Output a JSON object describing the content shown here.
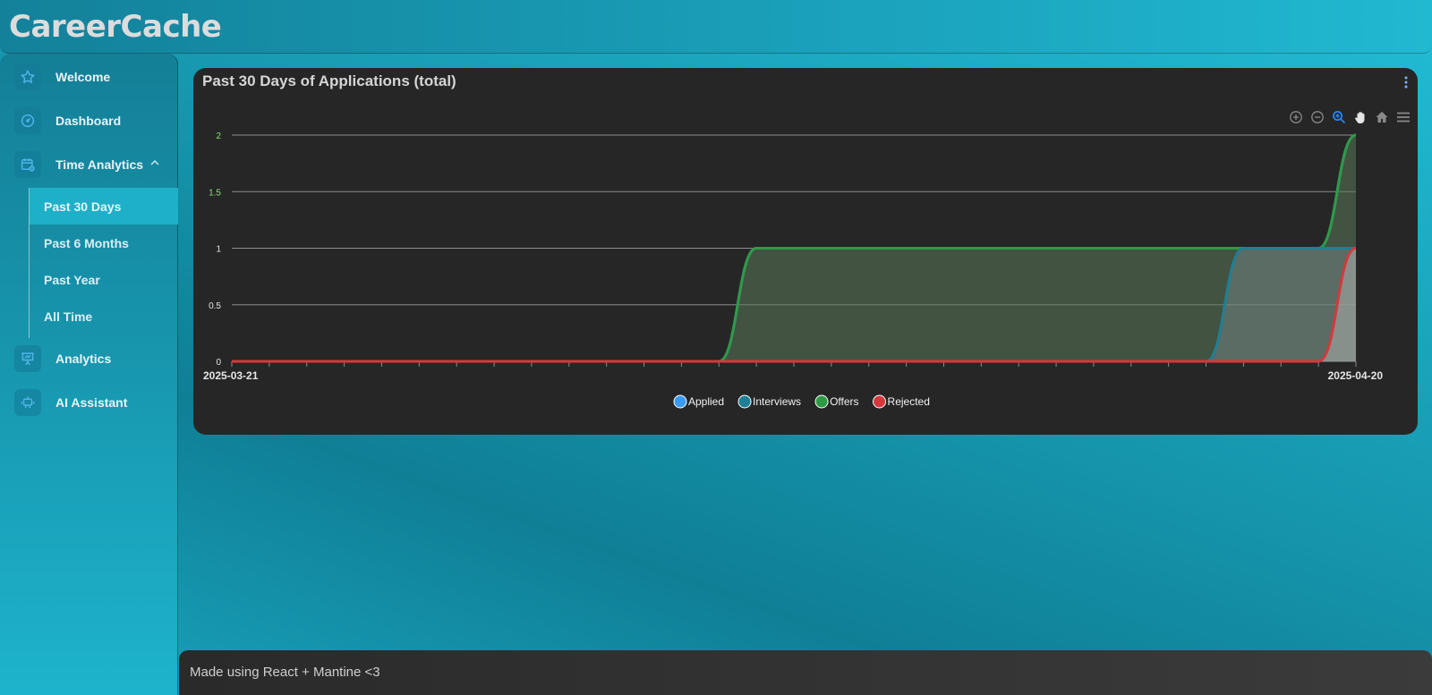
{
  "app": {
    "title": "CareerCache"
  },
  "sidebar": {
    "items": [
      {
        "label": "Welcome",
        "icon": "star-icon"
      },
      {
        "label": "Dashboard",
        "icon": "gauge-icon"
      },
      {
        "label": "Time Analytics",
        "icon": "calendar-icon",
        "expanded": true
      },
      {
        "label": "Analytics",
        "icon": "presentation-icon"
      },
      {
        "label": "AI Assistant",
        "icon": "robot-icon"
      }
    ],
    "sub_items": [
      {
        "label": "Past 30 Days",
        "active": true
      },
      {
        "label": "Past 6 Months",
        "active": false
      },
      {
        "label": "Past Year",
        "active": false
      },
      {
        "label": "All Time",
        "active": false
      }
    ]
  },
  "card": {
    "title": "Past 30 Days of Applications (total)",
    "toolbar": [
      "zoom-in-icon",
      "zoom-out-icon",
      "selection-zoom-icon",
      "pan-hand-icon",
      "reset-home-icon",
      "menu-icon"
    ]
  },
  "chart_data": {
    "type": "area",
    "title": "",
    "xlabel": "",
    "ylabel": "",
    "x_start": "2025-03-21",
    "x_end": "2025-04-20",
    "x_tick_labels": [
      "2025-03-21",
      "2025-04-20"
    ],
    "ylim": [
      0,
      2
    ],
    "y_ticks": [
      "0",
      "0.5",
      "1",
      "1.5",
      "2"
    ],
    "grid": true,
    "legend_position": "bottom-center",
    "x": [
      "2025-03-21",
      "2025-03-22",
      "2025-03-23",
      "2025-03-24",
      "2025-03-25",
      "2025-03-26",
      "2025-03-27",
      "2025-03-28",
      "2025-03-29",
      "2025-03-30",
      "2025-03-31",
      "2025-04-01",
      "2025-04-02",
      "2025-04-03",
      "2025-04-04",
      "2025-04-05",
      "2025-04-06",
      "2025-04-07",
      "2025-04-08",
      "2025-04-09",
      "2025-04-10",
      "2025-04-11",
      "2025-04-12",
      "2025-04-13",
      "2025-04-14",
      "2025-04-15",
      "2025-04-16",
      "2025-04-17",
      "2025-04-18",
      "2025-04-19",
      "2025-04-20"
    ],
    "series": [
      {
        "name": "Applied",
        "color": "#3b9bf0",
        "values": [
          0,
          0,
          0,
          0,
          0,
          0,
          0,
          0,
          0,
          0,
          0,
          0,
          0,
          0,
          1,
          1,
          1,
          1,
          1,
          1,
          1,
          1,
          1,
          1,
          1,
          1,
          1,
          1,
          1,
          1,
          2
        ]
      },
      {
        "name": "Interviews",
        "color": "#1f7f96",
        "values": [
          0,
          0,
          0,
          0,
          0,
          0,
          0,
          0,
          0,
          0,
          0,
          0,
          0,
          0,
          0,
          0,
          0,
          0,
          0,
          0,
          0,
          0,
          0,
          0,
          0,
          0,
          0,
          1,
          1,
          1,
          1
        ]
      },
      {
        "name": "Offers",
        "color": "#2f9a46",
        "values": [
          0,
          0,
          0,
          0,
          0,
          0,
          0,
          0,
          0,
          0,
          0,
          0,
          0,
          0,
          1,
          1,
          1,
          1,
          1,
          1,
          1,
          1,
          1,
          1,
          1,
          1,
          1,
          1,
          1,
          1,
          2
        ]
      },
      {
        "name": "Rejected",
        "color": "#d6383d",
        "values": [
          0,
          0,
          0,
          0,
          0,
          0,
          0,
          0,
          0,
          0,
          0,
          0,
          0,
          0,
          0,
          0,
          0,
          0,
          0,
          0,
          0,
          0,
          0,
          0,
          0,
          0,
          0,
          0,
          0,
          0,
          1
        ]
      }
    ]
  },
  "footer": {
    "text": "Made using React + Mantine <3"
  }
}
